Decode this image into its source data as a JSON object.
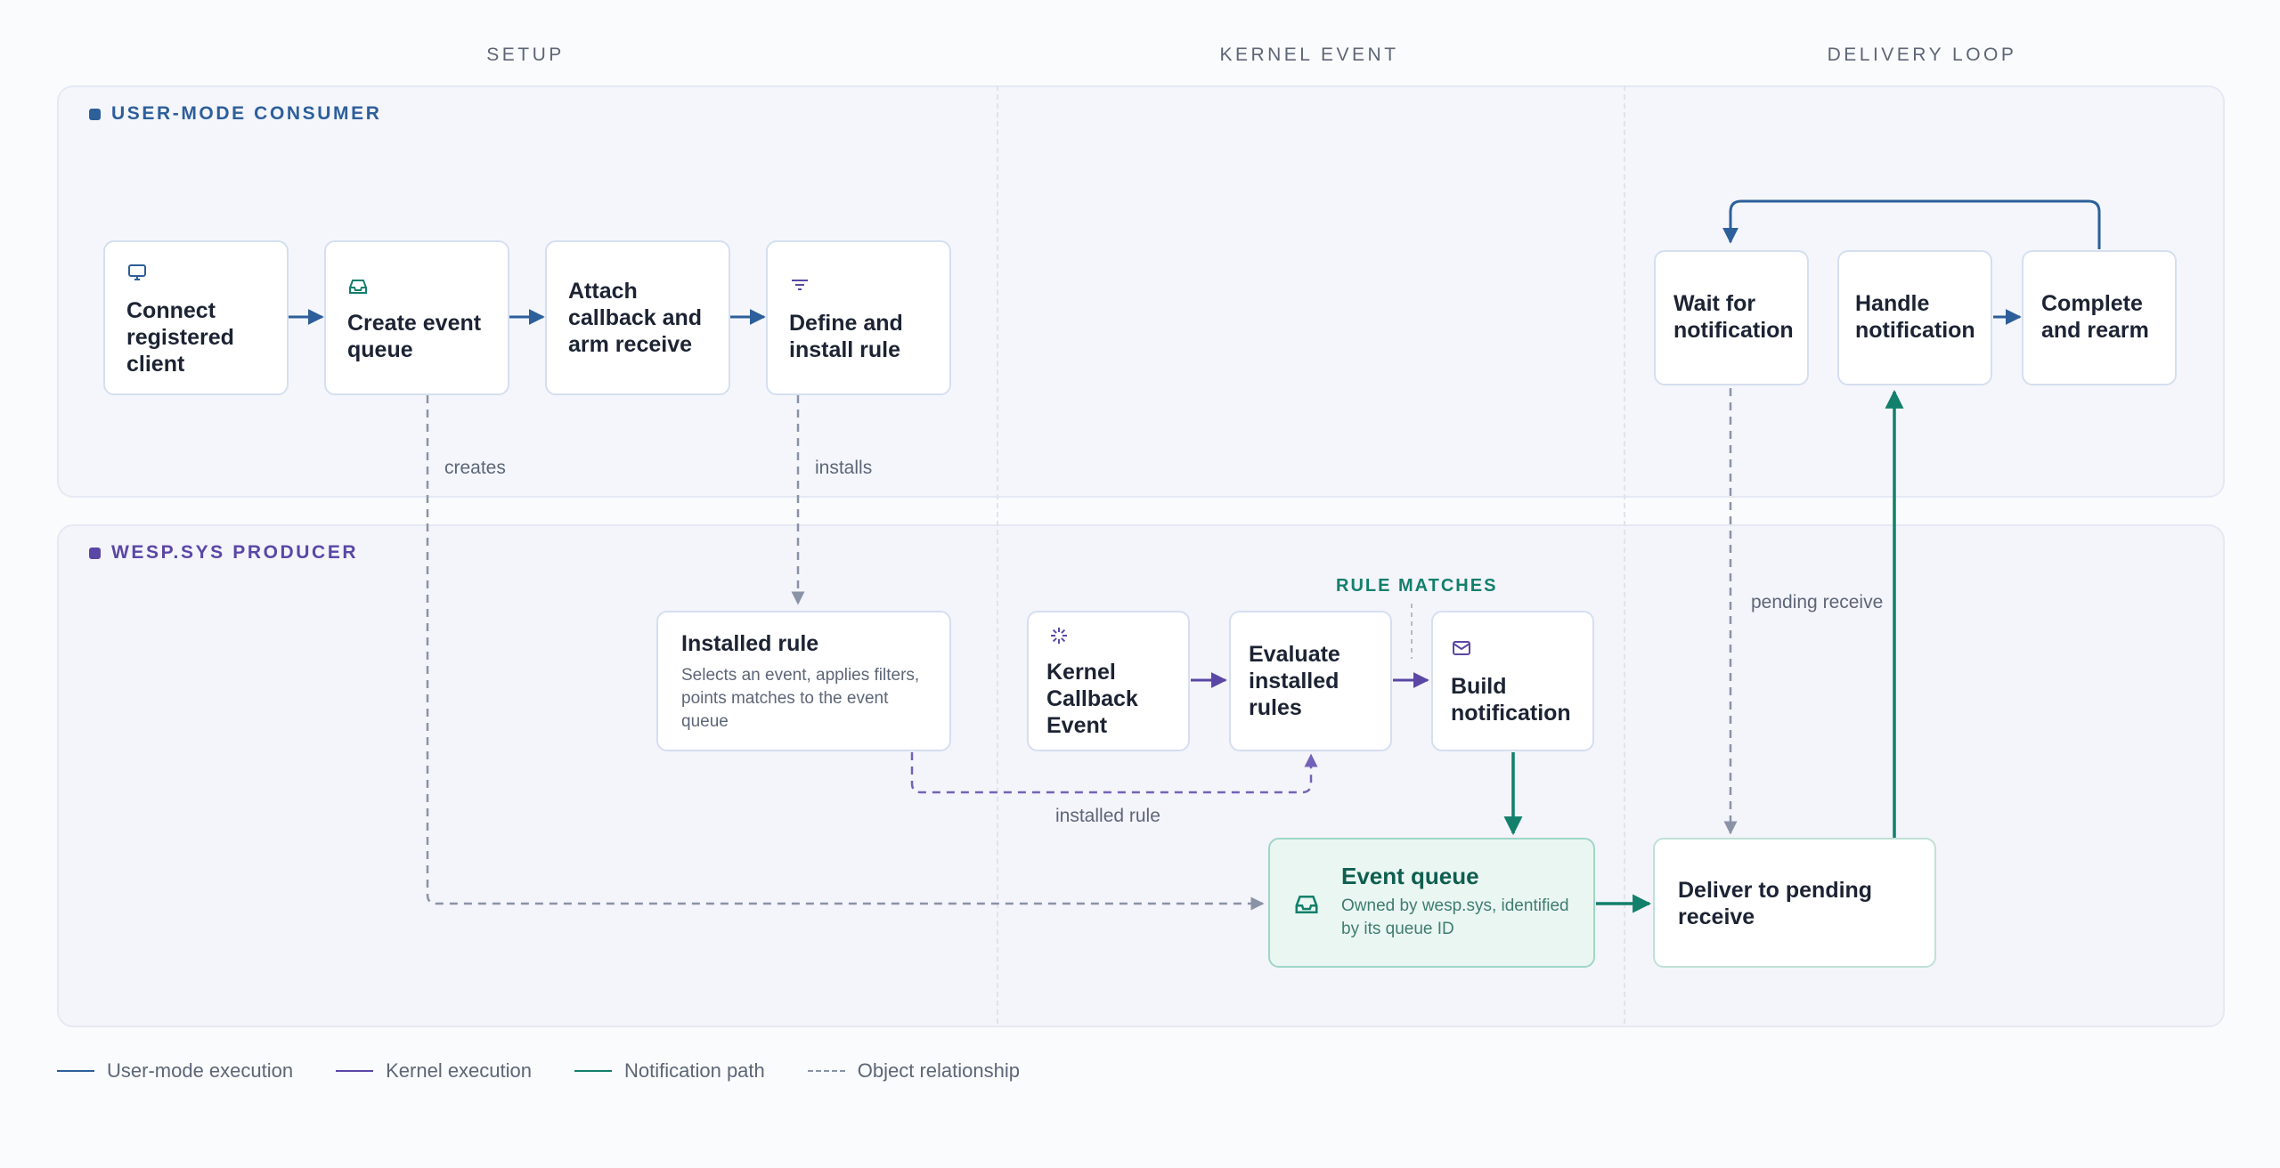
{
  "phases": {
    "setup": "SETUP",
    "kernel_event": "KERNEL EVENT",
    "delivery_loop": "DELIVERY LOOP"
  },
  "lanes": {
    "user": "USER-MODE CONSUMER",
    "kernel": "WESP.SYS PRODUCER"
  },
  "nodes": {
    "connect": "Connect registered client",
    "create_queue": "Create event queue",
    "attach": "Attach callback and arm receive",
    "define_rule": "Define and install rule",
    "wait": "Wait for notification",
    "handle": "Handle notification",
    "complete": "Complete and rearm",
    "installed_rule": {
      "title": "Installed rule",
      "desc": "Selects an event, applies filters, points matches to the event queue"
    },
    "kernel_callback": "Kernel Callback Event",
    "evaluate": "Evaluate installed rules",
    "build": "Build notification",
    "event_queue": {
      "title": "Event queue",
      "desc": "Owned by wesp.sys, identified by its queue ID"
    },
    "deliver": "Deliver to pending receive"
  },
  "edge_labels": {
    "creates": "creates",
    "installs": "installs",
    "rule_matches": "RULE MATCHES",
    "pending_receive": "pending receive",
    "installed_rule": "installed rule"
  },
  "legend": [
    {
      "label": "User-mode execution",
      "color": "#2d5f9a",
      "style": "solid"
    },
    {
      "label": "Kernel execution",
      "color": "#5a47a6",
      "style": "solid"
    },
    {
      "label": "Notification path",
      "color": "#12806b",
      "style": "solid"
    },
    {
      "label": "Object relationship",
      "color": "#8a93a6",
      "style": "dashed"
    }
  ],
  "icons": {
    "connect": "monitor-icon",
    "create_queue": "inbox-icon",
    "define_rule": "filter-icon",
    "kernel_callback": "spark-icon",
    "build": "mail-icon",
    "event_queue": "inbox-icon"
  },
  "colors": {
    "user": "#2d5f9a",
    "kernel": "#5a47a6",
    "notify": "#12806b",
    "relation": "#8a93a6"
  }
}
